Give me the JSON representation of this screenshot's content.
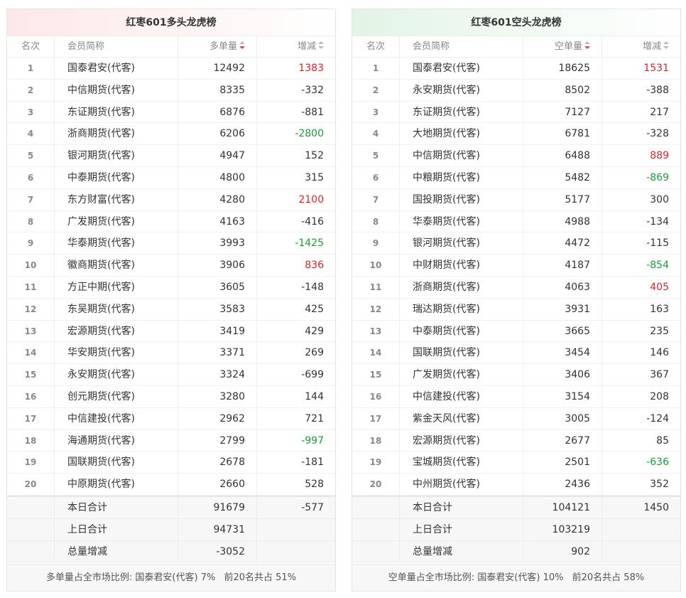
{
  "long_panel": {
    "title": "红枣601多头龙虎榜",
    "headers": {
      "rank": "名次",
      "name": "会员简称",
      "volume": "多单量",
      "change": "增减"
    },
    "rows": [
      {
        "rank": "1",
        "name": "国泰君安(代客)",
        "volume": "12492",
        "change": "1383",
        "color": "red"
      },
      {
        "rank": "2",
        "name": "中信期货(代客)",
        "volume": "8335",
        "change": "-332",
        "color": ""
      },
      {
        "rank": "3",
        "name": "东证期货(代客)",
        "volume": "6876",
        "change": "-881",
        "color": ""
      },
      {
        "rank": "4",
        "name": "浙商期货(代客)",
        "volume": "6206",
        "change": "-2800",
        "color": "green"
      },
      {
        "rank": "5",
        "name": "银河期货(代客)",
        "volume": "4947",
        "change": "152",
        "color": ""
      },
      {
        "rank": "6",
        "name": "中泰期货(代客)",
        "volume": "4800",
        "change": "315",
        "color": ""
      },
      {
        "rank": "7",
        "name": "东方财富(代客)",
        "volume": "4280",
        "change": "2100",
        "color": "red"
      },
      {
        "rank": "8",
        "name": "广发期货(代客)",
        "volume": "4163",
        "change": "-416",
        "color": ""
      },
      {
        "rank": "9",
        "name": "华泰期货(代客)",
        "volume": "3993",
        "change": "-1425",
        "color": "green"
      },
      {
        "rank": "10",
        "name": "徽商期货(代客)",
        "volume": "3906",
        "change": "836",
        "color": "red"
      },
      {
        "rank": "11",
        "name": "方正中期(代客)",
        "volume": "3605",
        "change": "-148",
        "color": ""
      },
      {
        "rank": "12",
        "name": "东吴期货(代客)",
        "volume": "3583",
        "change": "425",
        "color": ""
      },
      {
        "rank": "13",
        "name": "宏源期货(代客)",
        "volume": "3419",
        "change": "429",
        "color": ""
      },
      {
        "rank": "14",
        "name": "华安期货(代客)",
        "volume": "3371",
        "change": "269",
        "color": ""
      },
      {
        "rank": "15",
        "name": "永安期货(代客)",
        "volume": "3324",
        "change": "-699",
        "color": ""
      },
      {
        "rank": "16",
        "name": "创元期货(代客)",
        "volume": "3280",
        "change": "144",
        "color": ""
      },
      {
        "rank": "17",
        "name": "中信建投(代客)",
        "volume": "2962",
        "change": "721",
        "color": ""
      },
      {
        "rank": "18",
        "name": "海通期货(代客)",
        "volume": "2799",
        "change": "-997",
        "color": "green"
      },
      {
        "rank": "19",
        "name": "国联期货(代客)",
        "volume": "2678",
        "change": "-181",
        "color": ""
      },
      {
        "rank": "20",
        "name": "中原期货(代客)",
        "volume": "2660",
        "change": "528",
        "color": ""
      }
    ],
    "summary": [
      {
        "label": "本日合计",
        "volume": "91679",
        "change": "-577"
      },
      {
        "label": "上日合计",
        "volume": "94731",
        "change": ""
      },
      {
        "label": "总量增减",
        "volume": "-3052",
        "change": ""
      }
    ],
    "footnote": {
      "text": "多单量占全市场比例: 国泰君安(代客) 7%",
      "total": "前20名共占 51%"
    }
  },
  "short_panel": {
    "title": "红枣601空头龙虎榜",
    "headers": {
      "rank": "名次",
      "name": "会员简称",
      "volume": "空单量",
      "change": "增减"
    },
    "rows": [
      {
        "rank": "1",
        "name": "国泰君安(代客)",
        "volume": "18625",
        "change": "1531",
        "color": "red"
      },
      {
        "rank": "2",
        "name": "永安期货(代客)",
        "volume": "8502",
        "change": "-388",
        "color": ""
      },
      {
        "rank": "3",
        "name": "东证期货(代客)",
        "volume": "7127",
        "change": "217",
        "color": ""
      },
      {
        "rank": "4",
        "name": "大地期货(代客)",
        "volume": "6781",
        "change": "-328",
        "color": ""
      },
      {
        "rank": "5",
        "name": "中信期货(代客)",
        "volume": "6488",
        "change": "889",
        "color": "red"
      },
      {
        "rank": "6",
        "name": "中粮期货(代客)",
        "volume": "5482",
        "change": "-869",
        "color": "green"
      },
      {
        "rank": "7",
        "name": "国投期货(代客)",
        "volume": "5177",
        "change": "300",
        "color": ""
      },
      {
        "rank": "8",
        "name": "华泰期货(代客)",
        "volume": "4988",
        "change": "-134",
        "color": ""
      },
      {
        "rank": "9",
        "name": "银河期货(代客)",
        "volume": "4472",
        "change": "-115",
        "color": ""
      },
      {
        "rank": "10",
        "name": "中财期货(代客)",
        "volume": "4187",
        "change": "-854",
        "color": "green"
      },
      {
        "rank": "11",
        "name": "浙商期货(代客)",
        "volume": "4063",
        "change": "405",
        "color": "red"
      },
      {
        "rank": "12",
        "name": "瑞达期货(代客)",
        "volume": "3931",
        "change": "163",
        "color": ""
      },
      {
        "rank": "13",
        "name": "中泰期货(代客)",
        "volume": "3665",
        "change": "235",
        "color": ""
      },
      {
        "rank": "14",
        "name": "国联期货(代客)",
        "volume": "3454",
        "change": "146",
        "color": ""
      },
      {
        "rank": "15",
        "name": "广发期货(代客)",
        "volume": "3406",
        "change": "367",
        "color": ""
      },
      {
        "rank": "16",
        "name": "中信建投(代客)",
        "volume": "3154",
        "change": "208",
        "color": ""
      },
      {
        "rank": "17",
        "name": "紫金天风(代客)",
        "volume": "3005",
        "change": "-124",
        "color": ""
      },
      {
        "rank": "18",
        "name": "宏源期货(代客)",
        "volume": "2677",
        "change": "85",
        "color": ""
      },
      {
        "rank": "19",
        "name": "宝城期货(代客)",
        "volume": "2501",
        "change": "-636",
        "color": "green"
      },
      {
        "rank": "20",
        "name": "中州期货(代客)",
        "volume": "2436",
        "change": "352",
        "color": ""
      }
    ],
    "summary": [
      {
        "label": "本日合计",
        "volume": "104121",
        "change": "1450"
      },
      {
        "label": "上日合计",
        "volume": "103219",
        "change": ""
      },
      {
        "label": "总量增减",
        "volume": "902",
        "change": ""
      }
    ],
    "footnote": {
      "text": "空单量占全市场比例: 国泰君安(代客) 10%",
      "total": "前20名共占 58%"
    }
  },
  "colors": {
    "up": "#e8212a",
    "down": "#1a9c3a",
    "long_header_bg": "#fde8e8",
    "short_header_bg": "#e2f4e6"
  },
  "icons": {
    "sort": "sort-caret-icon"
  }
}
